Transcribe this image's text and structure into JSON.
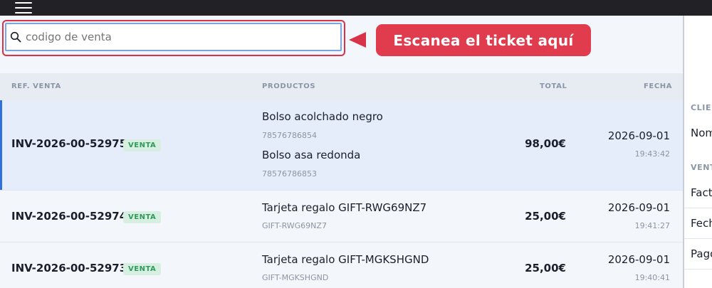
{
  "search": {
    "placeholder": "codigo de venta",
    "value": ""
  },
  "callout": {
    "text": "Escanea el ticket aquí"
  },
  "table": {
    "headers": {
      "ref": "REF. VENTA",
      "products": "PRODUCTOS",
      "total": "TOTAL",
      "date": "FECHA"
    },
    "rows": [
      {
        "ref": "INV-2026-00-52975",
        "badge": "VENTA",
        "products": [
          {
            "name": "Bolso acolchado negro",
            "sku": "78576786854"
          },
          {
            "name": "Bolso asa redonda",
            "sku": "78576786853"
          }
        ],
        "total": "98,00€",
        "date": "2026-09-01",
        "time": "19:43:42",
        "selected": true
      },
      {
        "ref": "INV-2026-00-52974",
        "badge": "VENTA",
        "products": [
          {
            "name": "Tarjeta regalo GIFT-RWG69NZ7",
            "sku": "GIFT-RWG69NZ7"
          }
        ],
        "total": "25,00€",
        "date": "2026-09-01",
        "time": "19:41:27",
        "selected": false
      },
      {
        "ref": "INV-2026-00-52973",
        "badge": "VENTA",
        "products": [
          {
            "name": "Tarjeta regalo GIFT-MGKSHGND",
            "sku": "GIFT-MGKSHGND"
          }
        ],
        "total": "25,00€",
        "date": "2026-09-01",
        "time": "19:40:41",
        "selected": false
      }
    ]
  },
  "right_panel": {
    "client_section": "CLIE",
    "client_name_label": "Nom",
    "sale_section": "VENT",
    "items": [
      "Fact",
      "Fech",
      "Pago"
    ]
  },
  "colors": {
    "topbar": "#222226",
    "accent": "#2f6fde",
    "callout": "#e03c4e",
    "badge_bg": "#d7efe0",
    "badge_text": "#2e9a5b"
  },
  "icons": {
    "menu": "hamburger-menu-icon",
    "search": "search-icon",
    "callout_arrow": "arrow-left-icon"
  }
}
